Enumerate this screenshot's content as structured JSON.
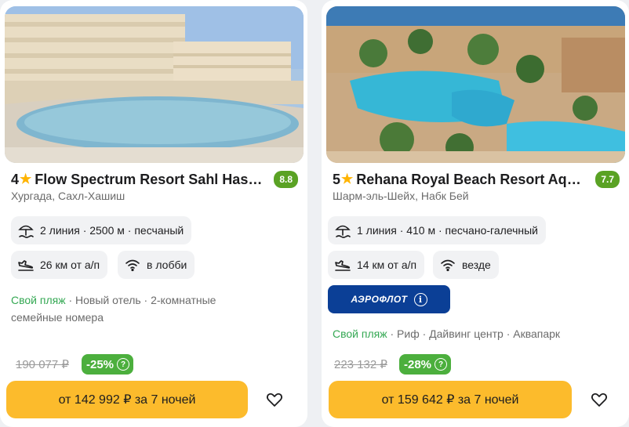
{
  "cards": [
    {
      "stars": "4",
      "name": "Flow Spectrum Resort Sahl Hasheesh",
      "rating": "8.8",
      "location": "Хургада, Сахл-Хашиш",
      "beach": "2 линия · 2500 м · песчаный",
      "airport": "26 км от а/п",
      "wifi": "в лобби",
      "features_green": "Свой пляж",
      "features_rest": " · Новый отель · 2-комнатные семейные номера",
      "old_price": "190 077 ₽",
      "discount": "-25%",
      "price": "от 142 992 ₽ за 7 ночей"
    },
    {
      "stars": "5",
      "name": "Rehana Royal Beach Resort Aquapark & Spa",
      "rating": "7.7",
      "location": "Шарм-эль-Шейх, Набк Бей",
      "beach": "1 линия · 410 м · песчано-галечный",
      "airport": "14 км от а/п",
      "wifi": "везде",
      "airline": "АЭРОФЛОТ",
      "features_green": "Свой пляж",
      "features_rest": " · Риф · Дайвинг центр · Аквапарк",
      "old_price": "223 132 ₽",
      "discount": "-28%",
      "price": "от 159 642 ₽ за 7 ночей"
    }
  ],
  "colors": {
    "rating_bg": "#5aa224",
    "star": "#ffb400",
    "discount_bg": "#4caf3d",
    "price_button": "#fcbb2c",
    "airline_bg": "#0b3f96",
    "feature_green": "#34a853"
  },
  "icons": {
    "star": "star-icon",
    "beach": "beach-umbrella-icon",
    "airport": "airplane-landing-icon",
    "wifi": "wifi-icon",
    "info": "info-icon",
    "discount_help": "question-icon",
    "favorite": "heart-icon"
  }
}
